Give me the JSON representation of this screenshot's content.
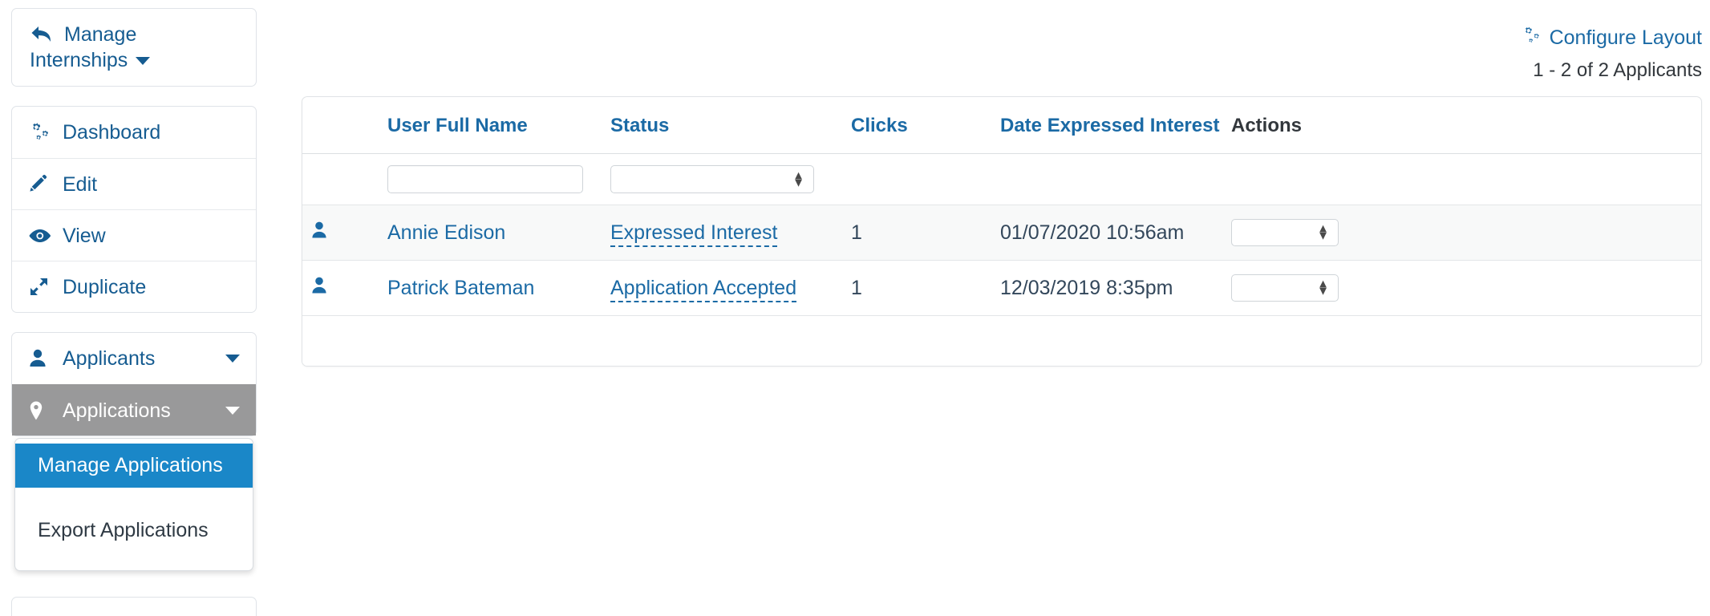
{
  "sidebar": {
    "back_panel": {
      "icon": "reply-arrow-icon",
      "line1": "Manage",
      "line2": "Internships"
    },
    "nav_items": [
      {
        "icon": "gears-icon",
        "label": "Dashboard"
      },
      {
        "icon": "pencil-icon",
        "label": "Edit"
      },
      {
        "icon": "eye-icon",
        "label": "View"
      },
      {
        "icon": "expand-icon",
        "label": "Duplicate"
      }
    ],
    "group_items": [
      {
        "icon": "user-icon",
        "label": "Applicants",
        "active": false,
        "has_caret": true
      },
      {
        "icon": "map-pin-icon",
        "label": "Applications",
        "active": true,
        "has_caret": true
      }
    ],
    "dropdown": {
      "items": [
        {
          "label": "Manage Applications",
          "selected": true
        },
        {
          "label": "Export Applications",
          "selected": false
        }
      ]
    }
  },
  "header": {
    "configure_layout_label": "Configure Layout",
    "configure_layout_icon": "gears-icon",
    "pagination_text": "1 - 2 of 2 Applicants"
  },
  "table": {
    "columns": [
      {
        "key": "icon",
        "label": ""
      },
      {
        "key": "name",
        "label": "User Full Name"
      },
      {
        "key": "status",
        "label": "Status"
      },
      {
        "key": "clicks",
        "label": "Clicks"
      },
      {
        "key": "date",
        "label": "Date Expressed Interest"
      },
      {
        "key": "actions",
        "label": "Actions"
      }
    ],
    "filters": {
      "name_value": "",
      "name_placeholder": "",
      "status_value": "",
      "status_options": [
        "",
        "Expressed Interest",
        "Application Accepted"
      ]
    },
    "rows": [
      {
        "icon": "user-avatar-icon",
        "name": "Annie Edison",
        "status": "Expressed Interest",
        "clicks": "1",
        "date": "01/07/2020 10:56am",
        "action_value": "",
        "action_options": [
          ""
        ]
      },
      {
        "icon": "user-avatar-icon",
        "name": "Patrick Bateman",
        "status": "Application Accepted",
        "clicks": "1",
        "date": "12/03/2019 8:35pm",
        "action_value": "",
        "action_options": [
          ""
        ]
      }
    ]
  },
  "colors": {
    "link_blue": "#1b6aa5",
    "active_gray": "#99999a",
    "selected_blue": "#1a87c8",
    "row_alt": "#f8f9f9",
    "border": "#e0e3e6"
  }
}
